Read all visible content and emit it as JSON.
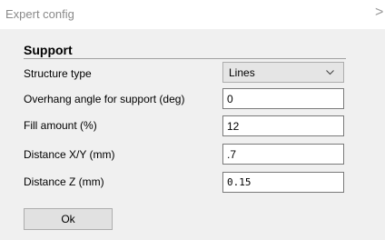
{
  "window": {
    "title": "Expert config",
    "close_glyph": ">"
  },
  "section": {
    "title": "Support"
  },
  "fields": {
    "structure_type": {
      "label": "Structure type",
      "value": "Lines"
    },
    "overhang_angle": {
      "label": "Overhang angle for support (deg)",
      "value": "0"
    },
    "fill_amount": {
      "label": "Fill amount (%)",
      "value": "12"
    },
    "distance_xy": {
      "label": "Distance X/Y (mm)",
      "value": ".7"
    },
    "distance_z": {
      "label": "Distance Z (mm)",
      "value": "0.15"
    }
  },
  "buttons": {
    "ok_label": "Ok"
  },
  "icons": {
    "combo_arrow": "chevron-down-icon",
    "close": "close-icon"
  },
  "colors": {
    "dialog_bg": "#f0f0f0",
    "title_text": "#8a8a8a",
    "section_line": "#a0a0a0"
  }
}
